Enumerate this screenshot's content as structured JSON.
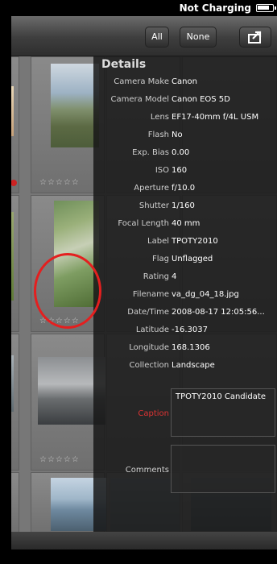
{
  "status_bar": {
    "charging_text": "Not Charging",
    "battery_icon": "battery-icon"
  },
  "toolbar": {
    "all_label": "All",
    "none_label": "None",
    "share_icon": "share-icon"
  },
  "details": {
    "title": "Details",
    "rows": [
      {
        "label": "Camera Make",
        "value": "Canon"
      },
      {
        "label": "Camera Model",
        "value": "Canon EOS 5D"
      },
      {
        "label": "Lens",
        "value": "EF17-40mm f/4L USM"
      },
      {
        "label": "Flash",
        "value": "No"
      },
      {
        "label": "Exp. Bias",
        "value": "0.00"
      },
      {
        "label": "ISO",
        "value": "160"
      },
      {
        "label": "Aperture",
        "value": "f/10.0"
      },
      {
        "label": "Shutter",
        "value": "1/160"
      },
      {
        "label": "Focal Length",
        "value": "40 mm"
      },
      {
        "label": "Label",
        "value": "TPOTY2010"
      },
      {
        "label": "Flag",
        "value": "Unflagged"
      },
      {
        "label": "Rating",
        "value": "4"
      },
      {
        "label": "Filename",
        "value": "va_dg_04_18.jpg"
      },
      {
        "label": "Date/Time",
        "value": "2008-08-17 12:05:56..."
      },
      {
        "label": "Latitude",
        "value": "-16.3037"
      },
      {
        "label": "Longitude",
        "value": "168.1306"
      },
      {
        "label": "Collection",
        "value": "Landscape"
      }
    ],
    "caption_label": "Caption",
    "caption_value": "TPOTY2010 Candidate",
    "comments_label": "Comments",
    "comments_value": ""
  },
  "grid": {
    "stars": "☆☆☆☆☆",
    "rating_stars": "★★★★☆"
  },
  "colors": {
    "accent_red": "#e41f1f",
    "caption_label": "#dd3333"
  }
}
